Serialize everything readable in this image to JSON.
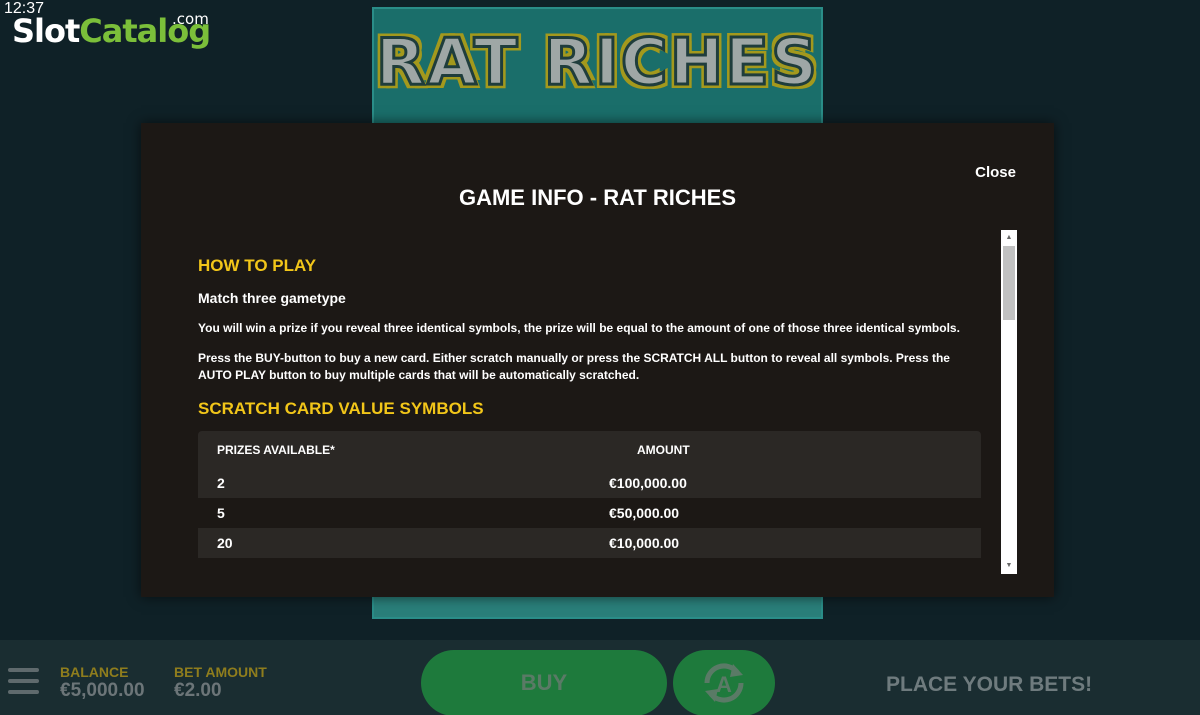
{
  "status": {
    "time": "12:37"
  },
  "brand": {
    "slot": "Slot",
    "catalog": "Catalog",
    "com": ".com"
  },
  "game": {
    "logo": "RAT RICHES"
  },
  "modal": {
    "close_label": "Close",
    "title": "GAME INFO - RAT RICHES",
    "how_to_play": {
      "heading": "HOW TO PLAY",
      "subheading": "Match three gametype",
      "paragraphs": [
        "You will win a prize if you reveal three identical symbols, the prize will be equal to the amount of one of those three identical symbols.",
        "Press the BUY-button to buy a new card. Either scratch manually or press the SCRATCH ALL button to reveal all symbols. Press the AUTO PLAY button to buy multiple cards that will be automatically scratched."
      ]
    },
    "scratch_values": {
      "heading": "SCRATCH CARD VALUE SYMBOLS",
      "columns": [
        "PRIZES AVAILABLE*",
        "AMOUNT"
      ],
      "rows": [
        {
          "prizes": "2",
          "amount": "€100,000.00"
        },
        {
          "prizes": "5",
          "amount": "€50,000.00"
        },
        {
          "prizes": "20",
          "amount": "€10,000.00"
        }
      ]
    },
    "scrollbar": {
      "up_icon": "triangle-up",
      "down_icon": "triangle-down"
    }
  },
  "bottom_bar": {
    "menu_icon": "hamburger-menu",
    "balance_label": "BALANCE",
    "balance_value": "€5,000.00",
    "bet_label": "BET AMOUNT",
    "bet_value": "€2.00",
    "buy_label": "BUY",
    "auto_icon": "autoplay-cycle",
    "status_text": "PLACE YOUR BETS!"
  },
  "colors": {
    "accent_yellow": "#f2c619",
    "button_green": "#1e7a3c",
    "brand_green": "#7bbf3a",
    "modal_bg": "#1c1815"
  }
}
